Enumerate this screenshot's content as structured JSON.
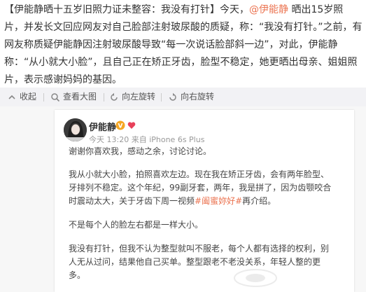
{
  "article": {
    "part1": "【伊能静晒十五岁旧照力证未整容：我没有打针】今天，",
    "mention1": "@伊能静",
    "part2": " 晒出15岁照片，并发长文回应网友对自己脸部注射玻尿酸的质疑，称：“我没有打针。”之前，有网友称质疑伊能静因注射玻尿酸导致“每一次说话脸部斜一边”，对此，伊能静称：“从小就大小脸”，且自己正在矫正牙齿，脸型不稳定，她更晒出母亲、姐姐照片，表示感谢妈妈的基因。"
  },
  "toolbar": {
    "collapse_label": "收起",
    "zoom_label": "查看大图",
    "rotate_left_label": "向左旋转",
    "rotate_right_label": "向右旋转"
  },
  "screenshot": {
    "username": "伊能静",
    "meta": "今天 13:20 来自 iPhone 6s Plus",
    "lines": {
      "l1": "谢谢你喜欢我，感动之余，讨论讨论。",
      "l2a": "我从小就大小脸，拍照喜欢左边。现在我在矫正牙齿，会有两年脸型、",
      "l2b": "牙排列不稳定。这个年纪，99副牙套，两年，我是拼了，因为齿颚咬合",
      "l2c_pre": "时震动太大，关于牙齿下周一视频",
      "l2c_tag": "#阖蜜妳好#",
      "l2c_post": "再介绍。",
      "l3": "不是每个人的脸左右都是一样大小。",
      "l4a": "我没有打针，但我不认为整型就叫不服老，每个人都有选择的权利，别",
      "l4b": "人无从过问，结果他自己买单。整型跟老不老没关系，年轻人整的更",
      "l4c": "多。"
    }
  },
  "colors": {
    "accent": "#eb7350",
    "text": "#333333",
    "toolbar_bg": "#f2f2f5",
    "panel_bg": "#f7f7f7"
  },
  "icons": {
    "collapse": "arrow-collapse-icon",
    "zoom": "magnifier-icon",
    "rotate_left": "rotate-left-icon",
    "rotate_right": "rotate-right-icon",
    "vip": "vip-badge-icon",
    "heart": "heart-icon"
  }
}
